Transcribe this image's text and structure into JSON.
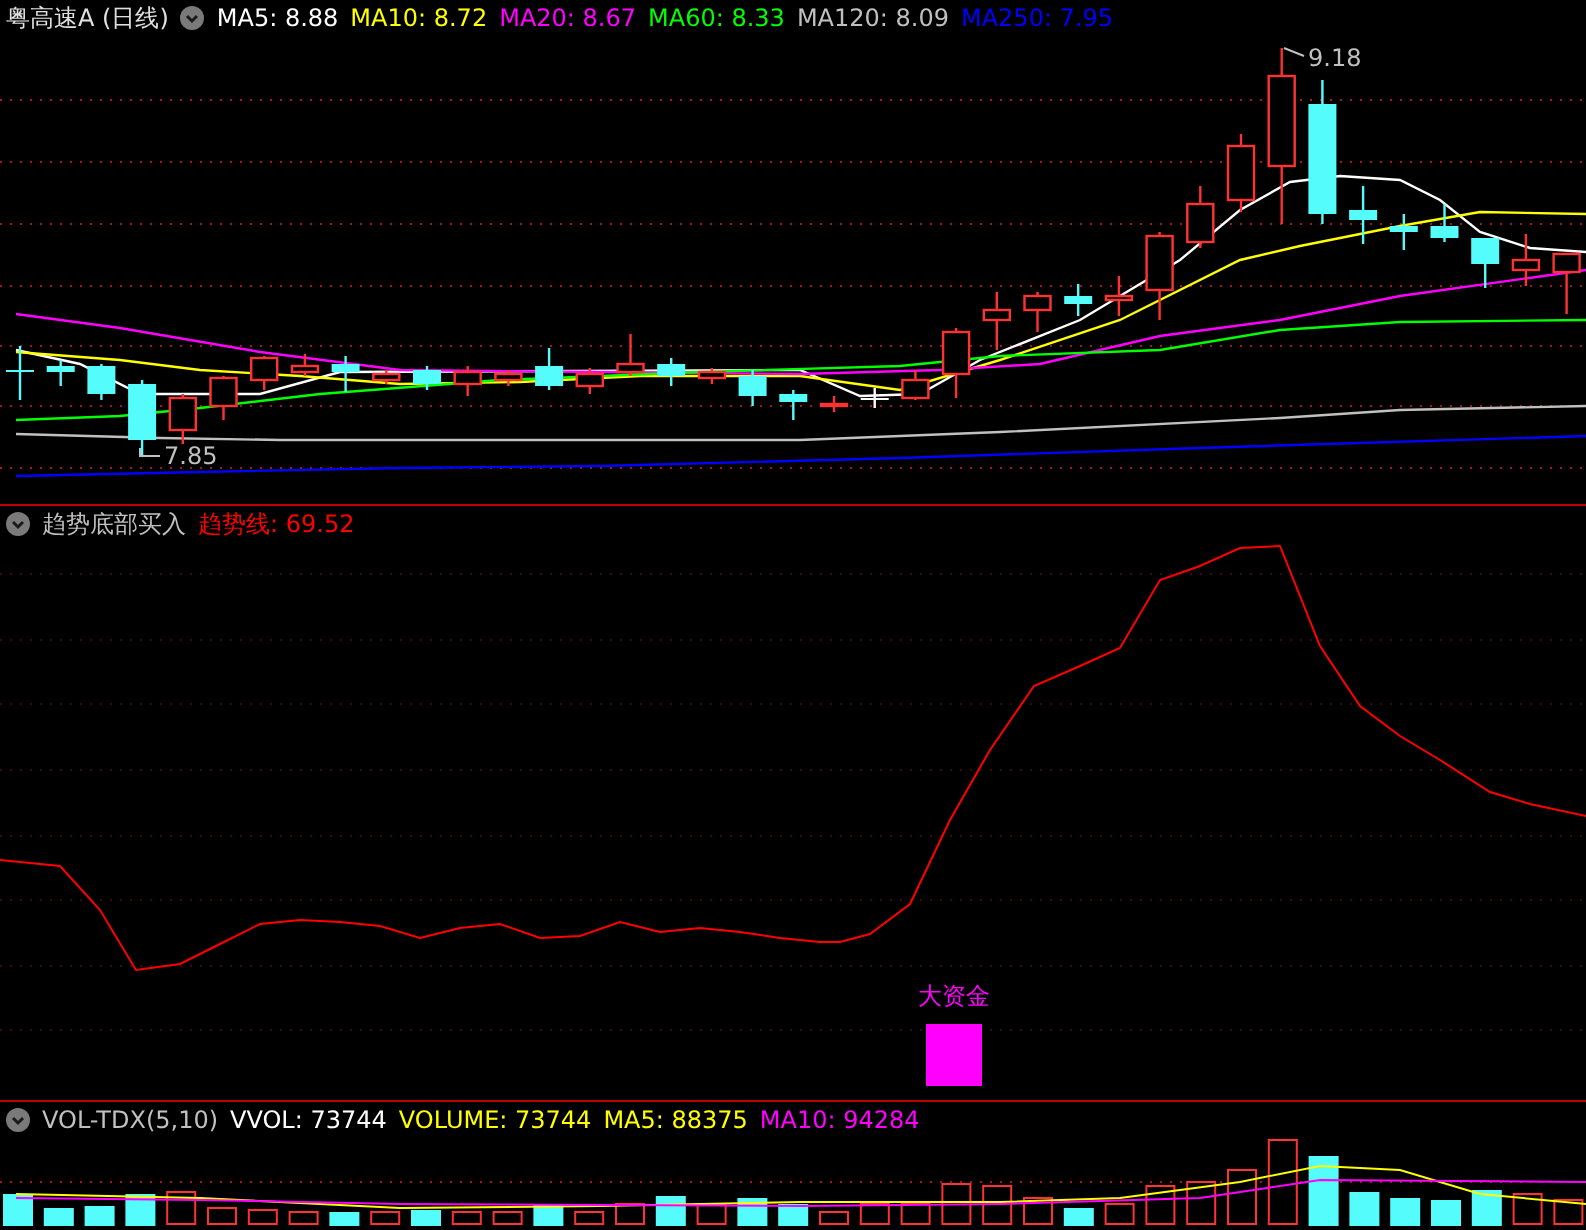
{
  "main_panel": {
    "title": "粤高速A (日线)",
    "indicators": [
      {
        "label": "MA5: 8.88",
        "color": "#ffffff"
      },
      {
        "label": "MA10: 8.72",
        "color": "#ffff00"
      },
      {
        "label": "MA20: 8.67",
        "color": "#ff00ff"
      },
      {
        "label": "MA60: 8.33",
        "color": "#00ff00"
      },
      {
        "label": "MA120: 8.09",
        "color": "#c0c0c0"
      },
      {
        "label": "MA250: 7.95",
        "color": "#0000ff"
      }
    ],
    "high_label": "9.18",
    "low_label": "7.85"
  },
  "trend_panel": {
    "title": "趋势底部买入",
    "indicators": [
      {
        "label": "趋势线: 69.52",
        "color": "#ff0000"
      }
    ],
    "signal_label": "大资金"
  },
  "volume_panel": {
    "title": "VOL-TDX(5,10)",
    "indicators": [
      {
        "label": "VVOL: 73744",
        "color": "#ffffff"
      },
      {
        "label": "VOLUME: 73744",
        "color": "#ffff00"
      },
      {
        "label": "MA5: 88375",
        "color": "#ffff00"
      },
      {
        "label": "MA10: 94284",
        "color": "#ff00ff"
      }
    ]
  }
}
